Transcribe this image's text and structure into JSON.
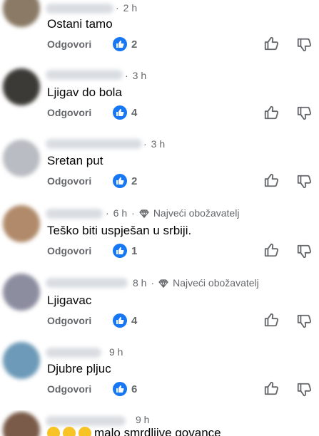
{
  "reply_label": "Odgovori",
  "top_fan_label": "Najveći obožavatelj",
  "like_color": "#1877f2",
  "icons": [
    "thumbs-up-icon",
    "thumbs-down-icon",
    "diamond-icon",
    "like-reaction-icon"
  ],
  "comments": [
    {
      "time": "2 h",
      "text": "Ostani tamo",
      "likes": "2"
    },
    {
      "time": "3 h",
      "text": "Ljigav do bola",
      "likes": "4"
    },
    {
      "time": "3 h",
      "text": "Sretan put",
      "likes": "2"
    },
    {
      "time": "6 h",
      "text": "Teško biti uspješan u srbiji.",
      "likes": "1"
    },
    {
      "time": "8 h",
      "text": "Ljigavac",
      "likes": "4"
    },
    {
      "time": "9 h",
      "text": "Djubre pljuc",
      "likes": "6"
    },
    {
      "time": "9 h",
      "text": "malo smrdljive govance"
    }
  ]
}
